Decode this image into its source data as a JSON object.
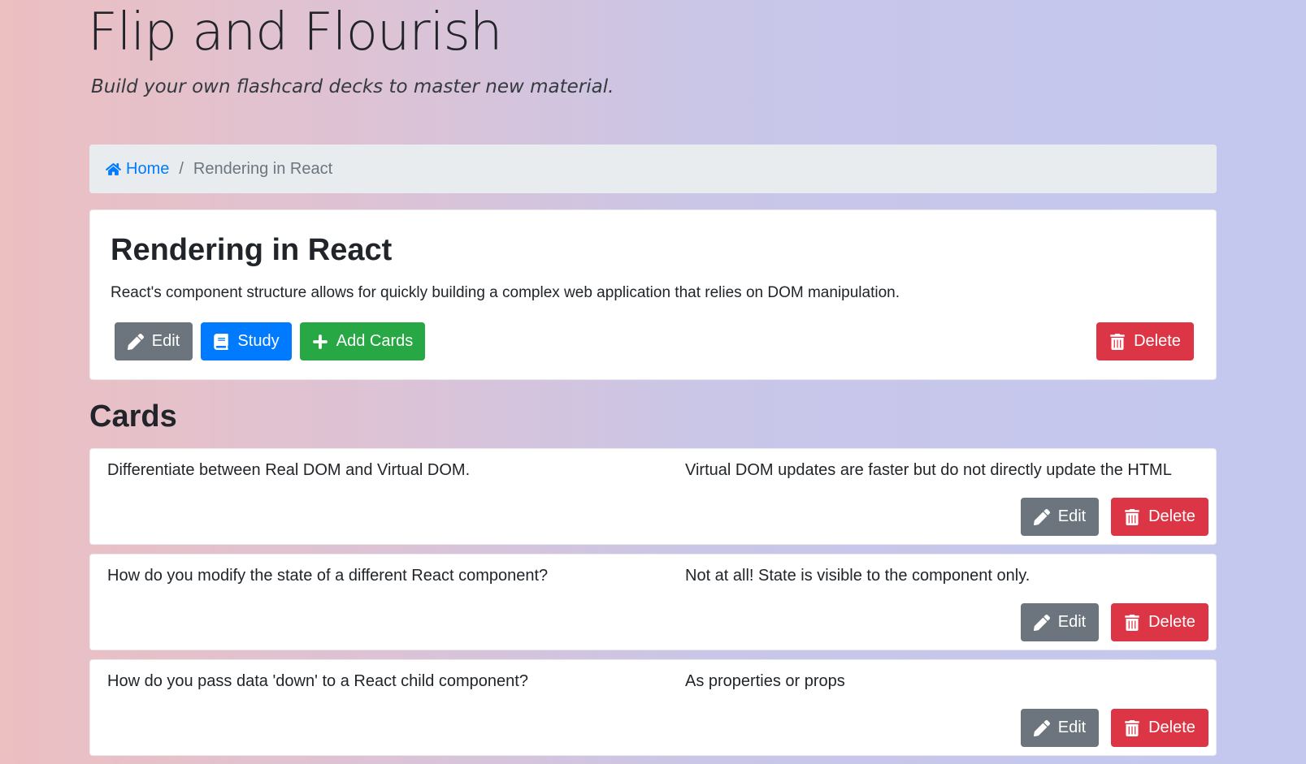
{
  "site": {
    "title": "Flip and Flourish",
    "subtitle": "Build your own flashcard decks to master new material."
  },
  "breadcrumb": {
    "home_label": "Home",
    "separator": "/",
    "current": "Rendering in React"
  },
  "deck": {
    "name": "Rendering in React",
    "description": "React's component structure allows for quickly building a complex web application that relies on DOM manipulation.",
    "edit_label": "Edit",
    "study_label": "Study",
    "add_cards_label": "Add Cards",
    "delete_label": "Delete"
  },
  "cards_section": {
    "heading": "Cards",
    "cards": [
      {
        "front": "Differentiate between Real DOM and Virtual DOM.",
        "back": "Virtual DOM updates are faster but do not directly update the HTML",
        "edit_label": "Edit",
        "delete_label": "Delete"
      },
      {
        "front": "How do you modify the state of a different React component?",
        "back": "Not at all! State is visible to the component only.",
        "edit_label": "Edit",
        "delete_label": "Delete"
      },
      {
        "front": "How do you pass data 'down' to a React child component?",
        "back": "As properties or props",
        "edit_label": "Edit",
        "delete_label": "Delete"
      }
    ]
  },
  "colors": {
    "primary": "#007bff",
    "secondary": "#6c757d",
    "success": "#28a745",
    "danger": "#dc3545",
    "breadcrumb_bg": "#e9ecef"
  },
  "icons": {
    "home": "home-icon",
    "edit": "pencil-icon",
    "study": "book-icon",
    "add": "plus-icon",
    "delete": "trash-icon"
  }
}
